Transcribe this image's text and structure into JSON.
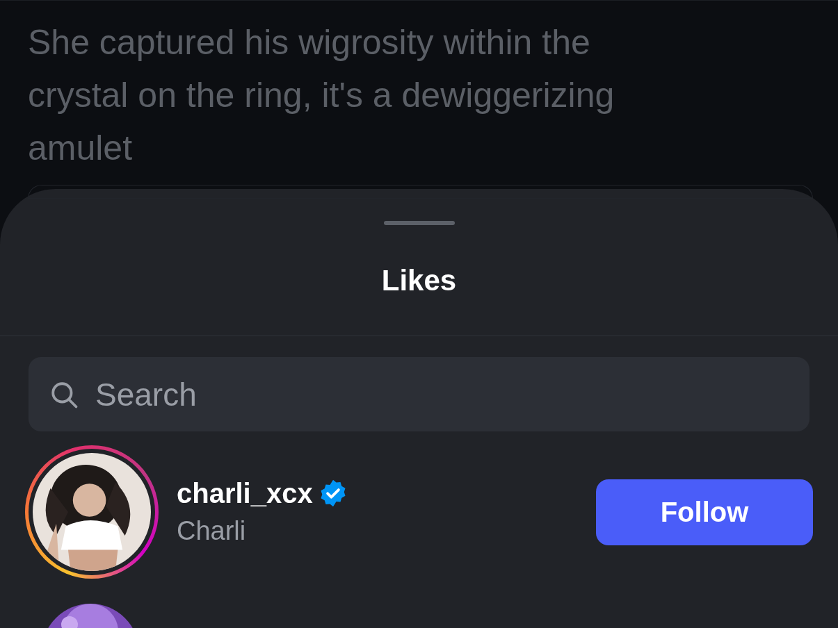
{
  "post": {
    "text": "She captured his wigrosity within the crystal on the ring, it's a dewiggerizing amulet"
  },
  "sheet": {
    "title": "Likes",
    "search": {
      "placeholder": "Search"
    },
    "users": [
      {
        "username": "charli_xcx",
        "name": "Charli",
        "verified": true,
        "has_story": true,
        "button": "Follow"
      }
    ]
  }
}
